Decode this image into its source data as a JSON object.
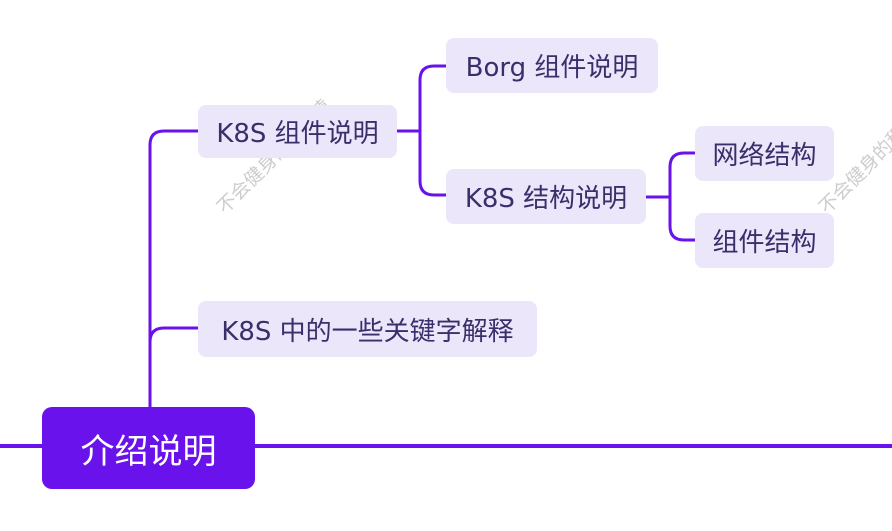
{
  "colors": {
    "root_fill": "#6a12ec",
    "root_text": "#ffffff",
    "node_fill": "#ebe6fa",
    "node_text": "#3a2f6b",
    "connector": "#6a12ec",
    "watermark_text": "#c8c8c8"
  },
  "mindmap": {
    "root": {
      "label": "介绍说明"
    },
    "branches": [
      {
        "label": "K8S 组件说明",
        "children": [
          {
            "label": "Borg 组件说明"
          },
          {
            "label": "K8S 结构说明",
            "children": [
              {
                "label": "网络结构"
              },
              {
                "label": "组件结构"
              }
            ]
          }
        ]
      },
      {
        "label": "K8S 中的一些关键字解释"
      }
    ]
  },
  "watermarks": [
    {
      "text": "不会健身的程序猿"
    },
    {
      "text": "不会健身的程序猿"
    }
  ]
}
